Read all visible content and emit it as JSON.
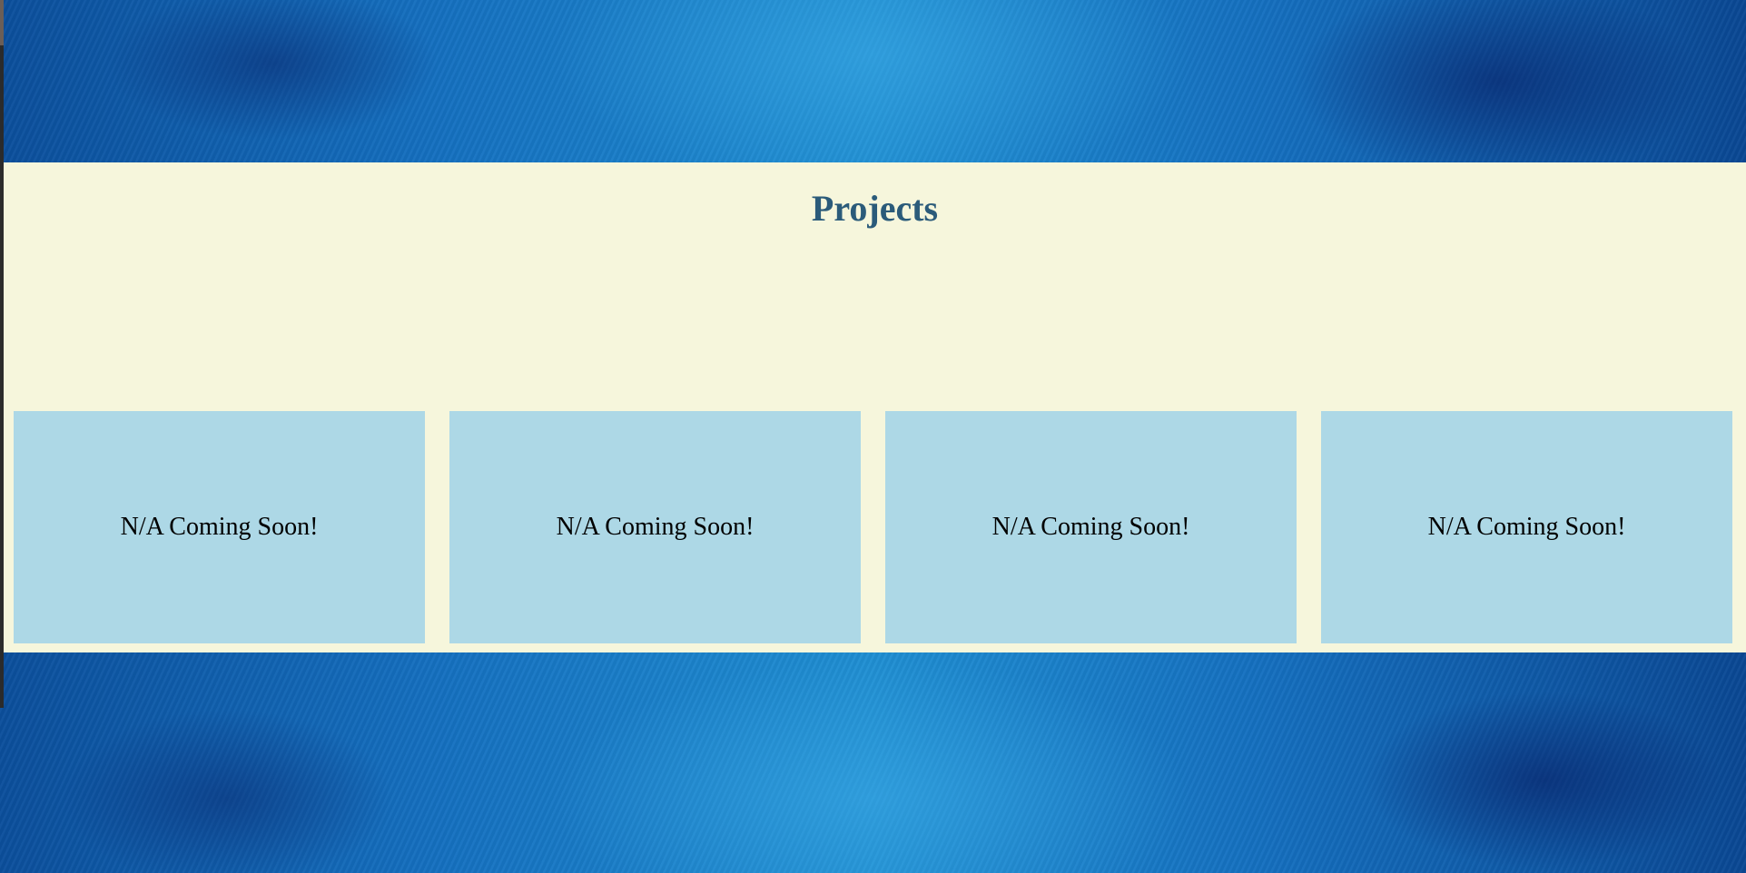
{
  "colors": {
    "section_background": "#f6f6dc",
    "title_color": "#2b5b7a",
    "card_background": "#add8e6",
    "page_background": "blue textured"
  },
  "projects": {
    "title": "Projects",
    "cards": [
      {
        "label": "N/A Coming Soon!"
      },
      {
        "label": "N/A Coming Soon!"
      },
      {
        "label": "N/A Coming Soon!"
      },
      {
        "label": "N/A Coming Soon!"
      }
    ]
  }
}
